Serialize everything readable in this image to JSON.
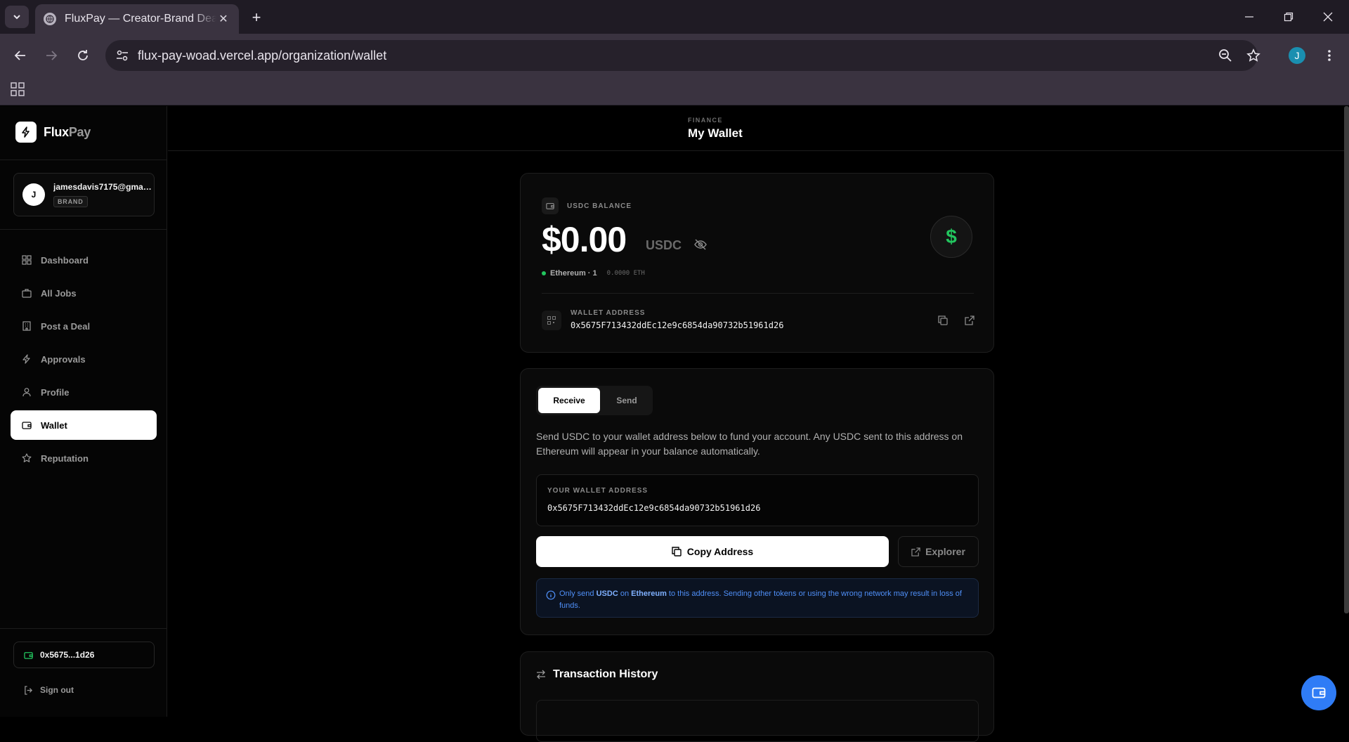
{
  "browser": {
    "tab_title": "FluxPay — Creator-Brand Deal Platform",
    "url": "flux-pay-woad.vercel.app/organization/wallet",
    "profile_initial": "J"
  },
  "sidebar": {
    "logo": {
      "flux": "Flux",
      "pay": "Pay"
    },
    "user": {
      "initial": "J",
      "email": "jamesdavis7175@gmail.com",
      "role": "BRAND"
    },
    "nav": [
      {
        "label": "Dashboard",
        "icon": "grid-icon"
      },
      {
        "label": "All Jobs",
        "icon": "briefcase-icon"
      },
      {
        "label": "Post a Deal",
        "icon": "building-icon"
      },
      {
        "label": "Approvals",
        "icon": "bolt-icon"
      },
      {
        "label": "Profile",
        "icon": "user-icon"
      },
      {
        "label": "Wallet",
        "icon": "wallet-icon",
        "active": true
      },
      {
        "label": "Reputation",
        "icon": "star-icon"
      }
    ],
    "wallet_chip": "0x5675...1d26",
    "signout": "Sign out"
  },
  "header": {
    "eyebrow": "FINANCE",
    "title": "My Wallet"
  },
  "balance": {
    "label": "USDC BALANCE",
    "amount": "$0.00",
    "unit": "USDC",
    "network": "Ethereum · 1",
    "eth": "0.0000 ETH",
    "wallet_address_label": "WALLET ADDRESS",
    "wallet_address": "0x5675F713432ddEc12e9c6854da90732b51961d26"
  },
  "receive": {
    "tabs": {
      "receive": "Receive",
      "send": "Send"
    },
    "description": "Send USDC to your wallet address below to fund your account. Any USDC sent to this address on Ethereum will appear in your balance automatically.",
    "address_label": "YOUR WALLET ADDRESS",
    "address": "0x5675F713432ddEc12e9c6854da90732b51961d26",
    "copy_label": "Copy Address",
    "explorer_label": "Explorer",
    "notice": {
      "pre": "Only send ",
      "token": "USDC",
      "mid": " on ",
      "network": "Ethereum",
      "post": " to this address. Sending other tokens or using the wrong network may result in loss of funds."
    }
  },
  "transactions": {
    "title": "Transaction History"
  },
  "colors": {
    "accent_green": "#22c55e",
    "info_blue": "#4f8ff7",
    "fab_blue": "#2f7cf6"
  }
}
